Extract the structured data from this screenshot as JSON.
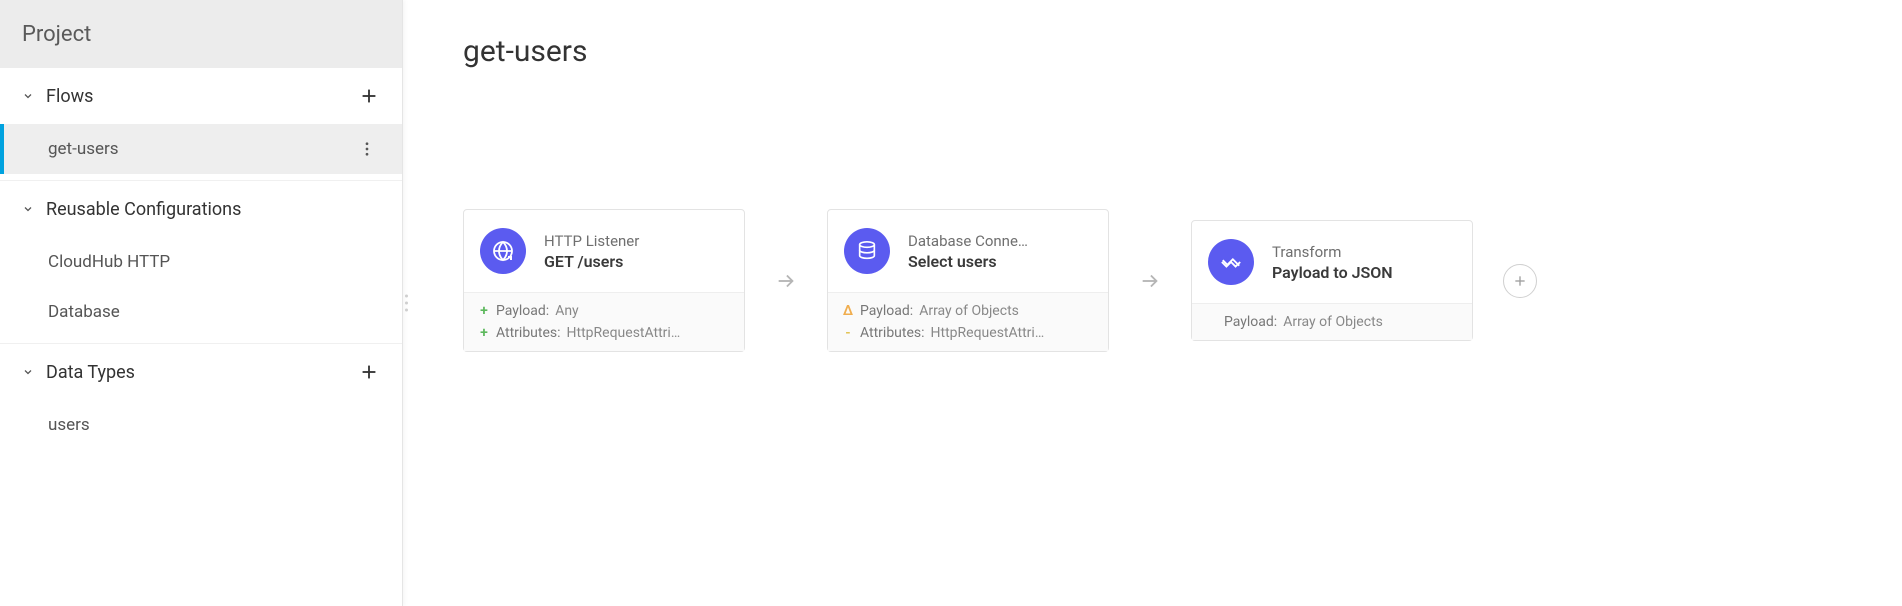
{
  "sidebar": {
    "title": "Project",
    "flows": {
      "label": "Flows",
      "items": [
        "get-users"
      ],
      "selected": 0
    },
    "configs": {
      "label": "Reusable Configurations",
      "items": [
        "CloudHub HTTP",
        "Database"
      ]
    },
    "dataTypes": {
      "label": "Data Types",
      "items": [
        "users"
      ]
    }
  },
  "canvas": {
    "title": "get-users",
    "cards": [
      {
        "icon": "globe",
        "type": "HTTP Listener",
        "name": "GET /users",
        "meta": [
          {
            "sym": "+",
            "key": "Payload:",
            "val": "Any"
          },
          {
            "sym": "+",
            "key": "Attributes:",
            "val": "HttpRequestAttri…"
          }
        ]
      },
      {
        "icon": "db",
        "type": "Database Conne…",
        "name": "Select users",
        "meta": [
          {
            "sym": "Δ",
            "key": "Payload:",
            "val": "Array of Objects"
          },
          {
            "sym": "-",
            "key": "Attributes:",
            "val": "HttpRequestAttri…"
          }
        ]
      },
      {
        "icon": "transform",
        "type": "Transform",
        "name": "Payload to JSON",
        "meta": [
          {
            "sym": "",
            "key": "Payload:",
            "val": "Array of Objects"
          }
        ]
      }
    ]
  }
}
